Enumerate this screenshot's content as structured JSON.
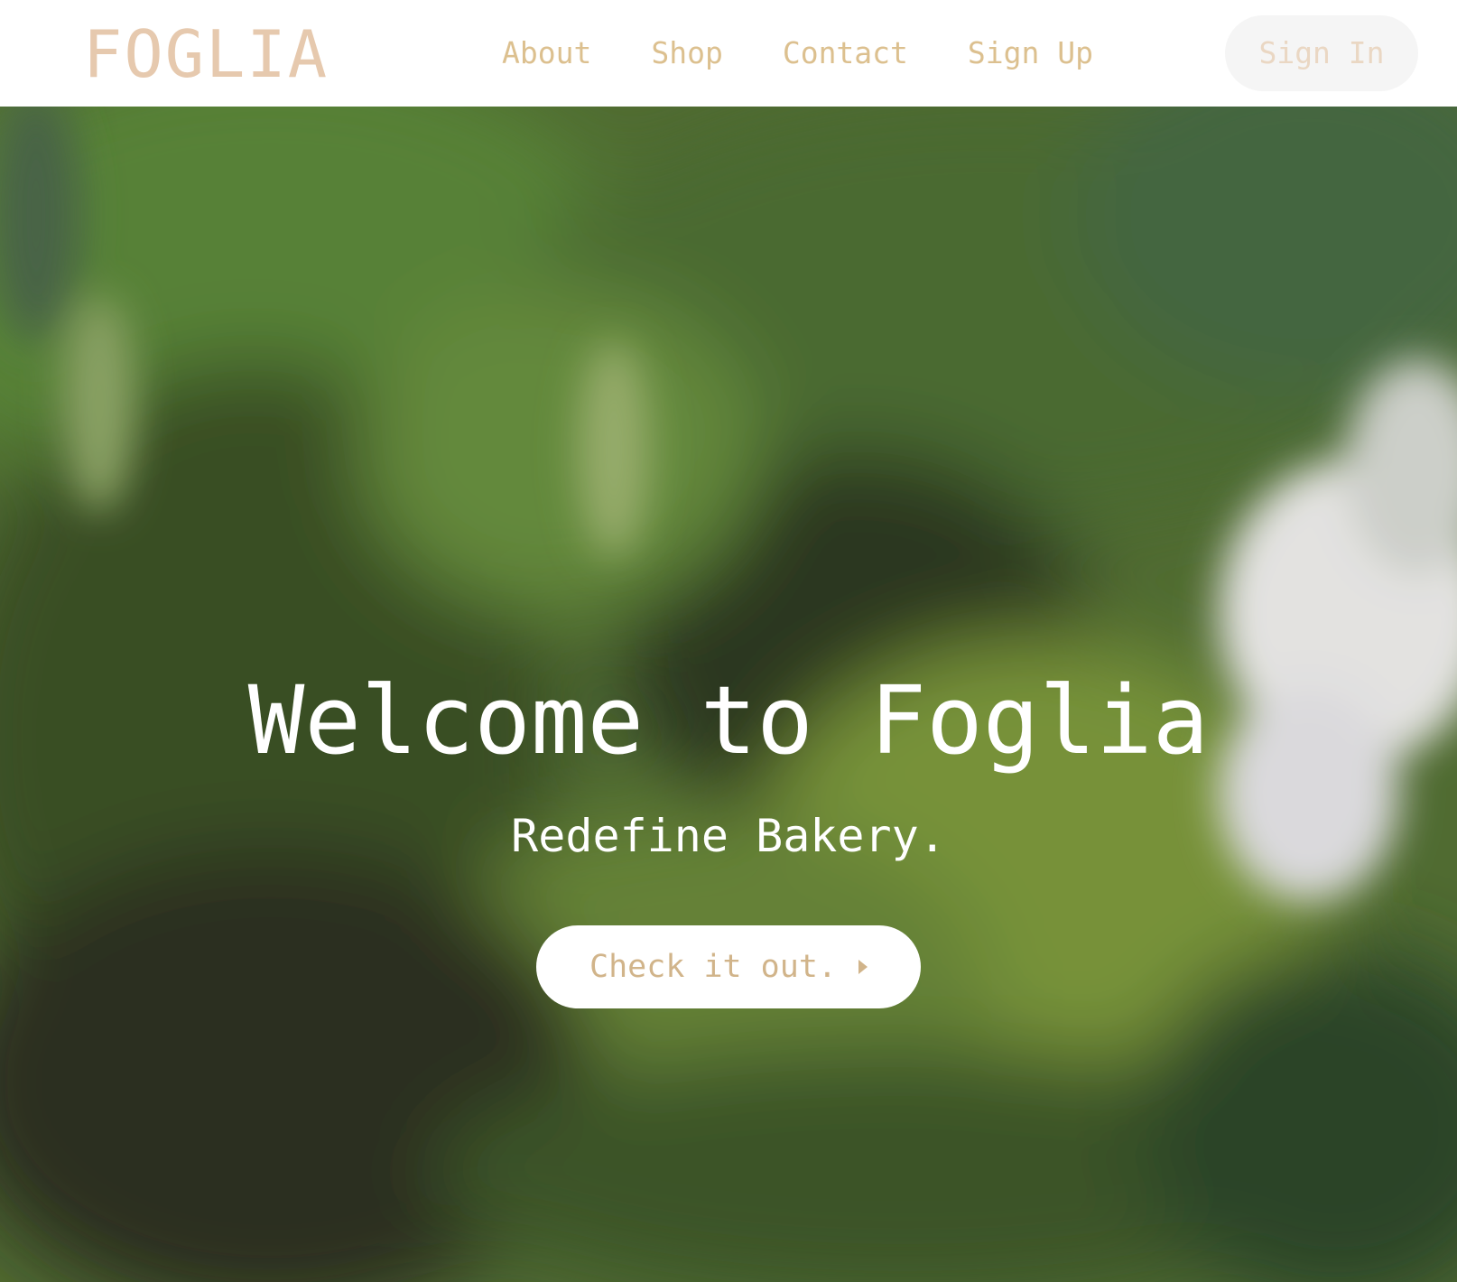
{
  "brand": {
    "logo_text": "FOGLIA"
  },
  "nav": {
    "items": [
      {
        "label": "About"
      },
      {
        "label": "Shop"
      },
      {
        "label": "Contact"
      },
      {
        "label": "Sign Up"
      }
    ],
    "sign_in_label": "Sign In"
  },
  "hero": {
    "title": "Welcome to Foglia",
    "subtitle": "Redefine Bakery.",
    "cta_label": "Check it out.",
    "cta_icon": "chevron-right-icon",
    "background": "blurred green leaves photo"
  },
  "colors": {
    "logo": "#e6c9ae",
    "nav_link": "#dcc08f",
    "sign_in_bg": "#f5f5f5",
    "sign_in_text": "#ead7c3",
    "cta_text": "#d1b48a",
    "hero_text": "#ffffff"
  }
}
